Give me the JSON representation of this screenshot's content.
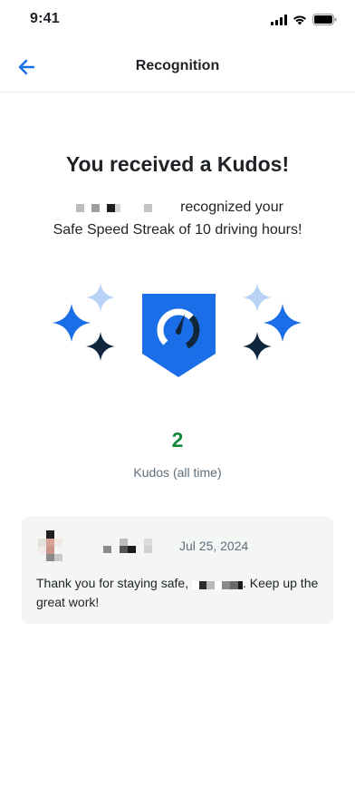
{
  "status_bar": {
    "time": "9:41",
    "icons": [
      "cellular-signal-icon",
      "wifi-icon",
      "battery-icon"
    ]
  },
  "nav": {
    "title": "Recognition",
    "back_icon": "arrow-left-icon"
  },
  "headline": "You received a Kudos!",
  "subtext": {
    "line1_suffix": "recognized your",
    "line2": "Safe Speed Streak of 10 driving hours!"
  },
  "badge": {
    "icon": "speedometer-shield-icon",
    "decorations": "sparkle-icons"
  },
  "stats": {
    "count": "2",
    "label": "Kudos (all time)"
  },
  "kudos_card": {
    "date": "Jul 25, 2024",
    "message_prefix": "Thank you for staying safe,",
    "message_suffix": ". Keep up the great work!"
  },
  "colors": {
    "accent_blue": "#1a6ee8",
    "light_blue": "#b9d3f7",
    "dark_navy": "#10263d",
    "count_green": "#128a3a",
    "card_bg": "#f4f6f6",
    "muted_text": "#5d6e7c"
  }
}
